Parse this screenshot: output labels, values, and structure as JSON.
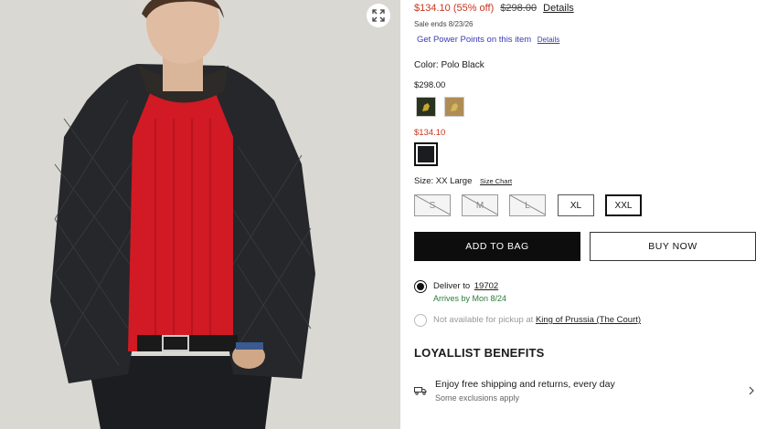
{
  "price": {
    "sale": "$134.10 (55% off)",
    "original": "$298.00",
    "details_link": "Details",
    "sale_ends": "Sale ends 8/23/26",
    "power_points": "Get Power Points on this item",
    "power_points_details": "Details"
  },
  "color": {
    "label": "Color:",
    "value": "Polo Black",
    "group1_price": "$298.00",
    "group2_price": "$134.10",
    "swatches": [
      {
        "name": "dark green",
        "color": "#2a3320"
      },
      {
        "name": "tan",
        "color": "#b08c55"
      },
      {
        "name": "Polo Black",
        "color": "#1a1c20"
      }
    ]
  },
  "size": {
    "label": "Size:",
    "value": "XX Large",
    "chart_link": "Size Chart",
    "options": [
      {
        "label": "S",
        "state": "unavailable"
      },
      {
        "label": "M",
        "state": "unavailable"
      },
      {
        "label": "L",
        "state": "unavailable"
      },
      {
        "label": "XL",
        "state": "available"
      },
      {
        "label": "XXL",
        "state": "selected"
      }
    ]
  },
  "actions": {
    "add_to_bag": "ADD TO BAG",
    "buy_now": "BUY NOW"
  },
  "delivery": {
    "deliver_to": "Deliver to",
    "zip": "19702",
    "arrives": "Arrives by Mon 8/24",
    "pickup_text": "Not available for pickup at",
    "store": "King of Prussia (The Court)"
  },
  "loyallist": {
    "heading": "LOYALLIST BENEFITS",
    "benefit_title": "Enjoy free shipping and returns, every day",
    "benefit_sub": "Some exclusions apply"
  },
  "colors": {
    "sale_red": "#c8341c",
    "link_blue": "#3b3bb8",
    "green": "#2a7d3c"
  }
}
